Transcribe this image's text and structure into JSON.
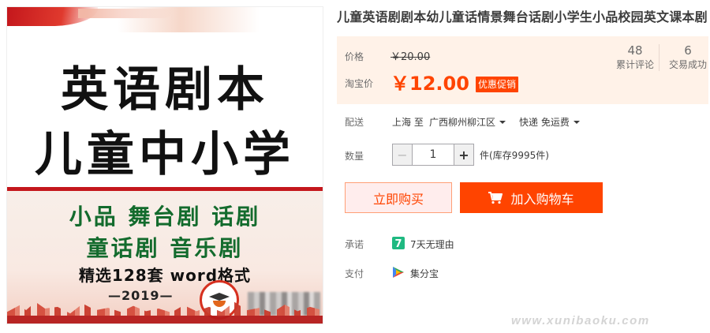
{
  "product_image": {
    "title_line1": "英语剧本",
    "title_line2": "儿童中小学",
    "line_a": "小品 舞台剧 话剧",
    "line_b": "童话剧 音乐剧",
    "line_c": "精选128套 word格式",
    "year": "—2019—"
  },
  "title": "儿童英语剧剧本幼儿童话情景舞台话剧小学生小品校园英文课本剧",
  "price": {
    "price_label": "价格",
    "original_price": "￥20.00",
    "taobao_label": "淘宝价",
    "promo_price": "￥12.00",
    "promo_badge": "优惠促销"
  },
  "stats": [
    {
      "value": "48",
      "label": "累计评论"
    },
    {
      "value": "6",
      "label": "交易成功"
    }
  ],
  "shipping": {
    "label": "配送",
    "from": "上海 至",
    "to": "广西柳州柳江区",
    "method": "快递 免运费"
  },
  "quantity": {
    "label": "数量",
    "value": "1",
    "minus": "−",
    "plus": "+",
    "stock": "件(库存9995件)"
  },
  "buttons": {
    "buy_now": "立即购买",
    "add_to_cart": "加入购物车"
  },
  "promise": {
    "label": "承诺",
    "icon": "seven-day-return-icon",
    "icon_text": "7",
    "text": "7天无理由"
  },
  "payment": {
    "label": "支付",
    "icon": "jifenbao-icon",
    "text": "集分宝"
  },
  "watermark": "www.xunibaoku.com",
  "colors": {
    "accent": "#ff4400",
    "price_bg": "#fff2e8",
    "image_green": "#136b2d",
    "image_red": "#c4171c"
  }
}
